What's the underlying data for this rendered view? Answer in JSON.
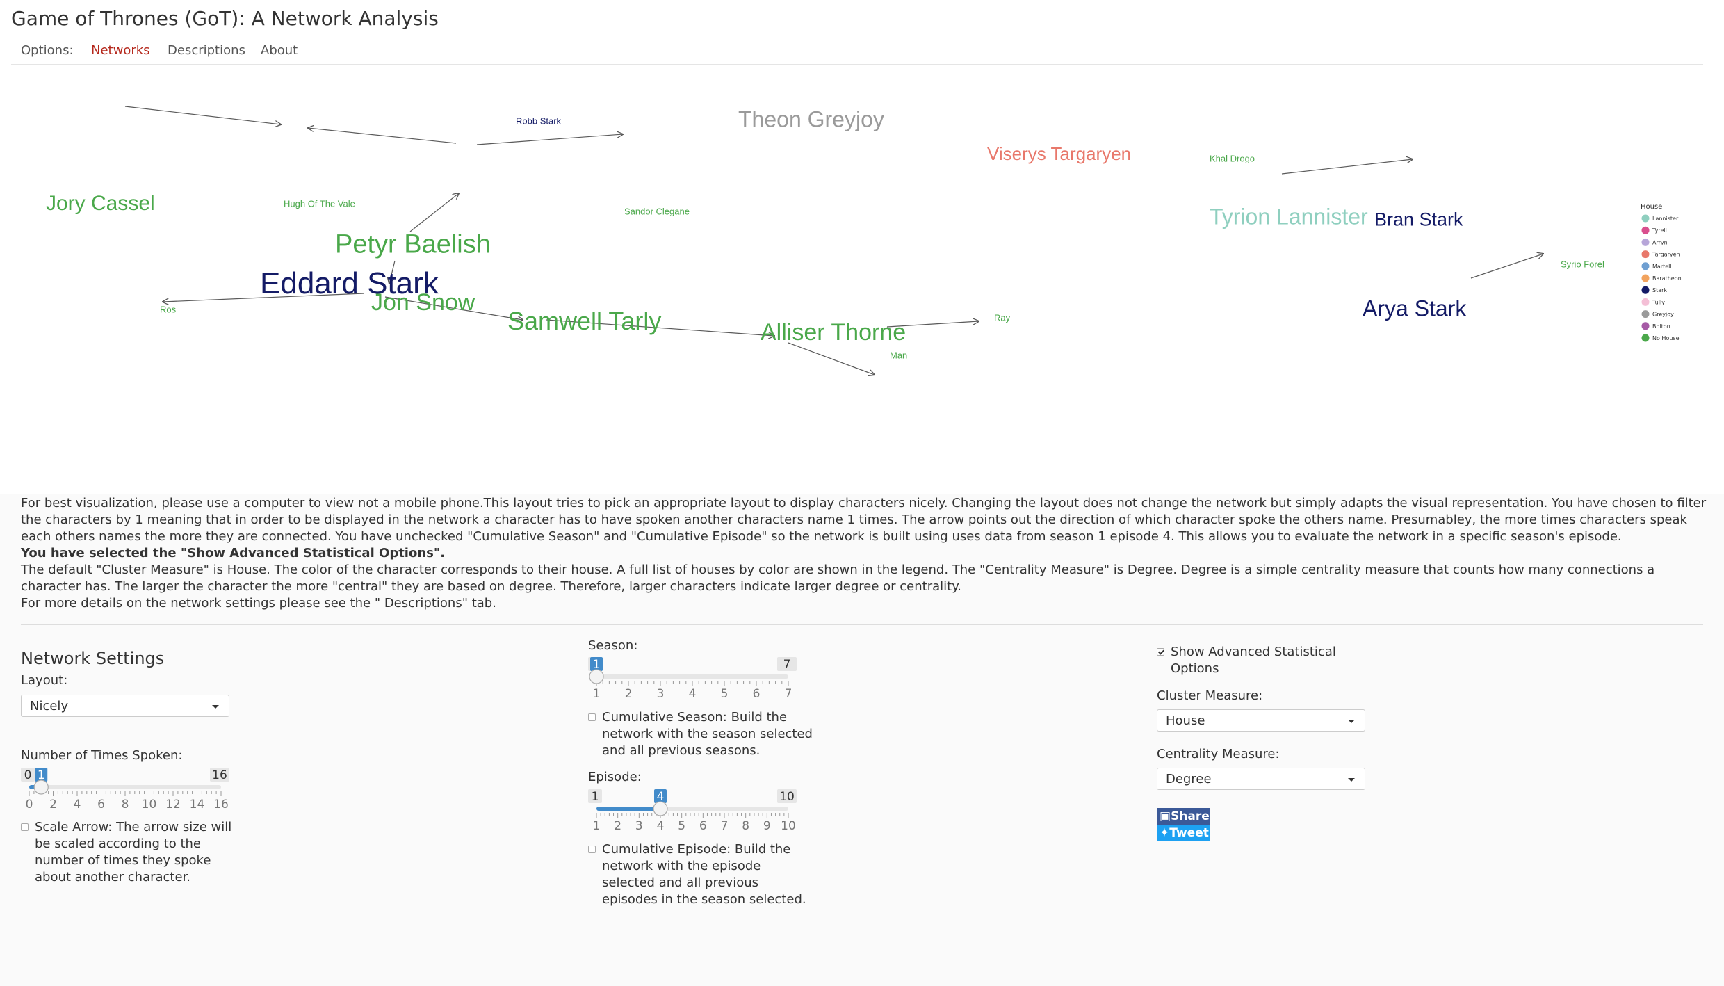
{
  "app_title": "Game of Thrones (GoT): A Network Analysis",
  "nav": {
    "label": "Options:",
    "tabs": [
      {
        "label": "Networks",
        "active": true
      },
      {
        "label": "Descriptions",
        "active": false
      },
      {
        "label": "About",
        "active": false
      }
    ]
  },
  "network": {
    "nodes": {
      "robb_stark": {
        "label": "Robb Stark",
        "color": "#141b66"
      },
      "theon_greyjoy": {
        "label": "Theon Greyjoy",
        "color": "#9a9a9a"
      },
      "viserys_targaryen": {
        "label": "Viserys Targaryen",
        "color": "#e8786b"
      },
      "khal_drogo": {
        "label": "Khal Drogo",
        "color": "#4aa84a"
      },
      "jory_cassel": {
        "label": "Jory Cassel",
        "color": "#4aa84a"
      },
      "hugh_of_the_vale": {
        "label": "Hugh Of The Vale",
        "color": "#4aa84a"
      },
      "sandor_clegane": {
        "label": "Sandor Clegane",
        "color": "#4aa84a"
      },
      "petyr_baelish": {
        "label": "Petyr Baelish",
        "color": "#4aa84a"
      },
      "tyrion_lannister": {
        "label": "Tyrion Lannister",
        "color": "#8fcfbf"
      },
      "bran_stark": {
        "label": "Bran Stark",
        "color": "#141b66"
      },
      "eddard_stark": {
        "label": "Eddard Stark",
        "color": "#141b66"
      },
      "jon_snow": {
        "label": "Jon Snow",
        "color": "#4aa84a"
      },
      "syrio_forel": {
        "label": "Syrio Forel",
        "color": "#4aa84a"
      },
      "arya_stark": {
        "label": "Arya Stark",
        "color": "#141b66"
      },
      "ros": {
        "label": "Ros",
        "color": "#4aa84a"
      },
      "samwell_tarly": {
        "label": "Samwell Tarly",
        "color": "#4aa84a"
      },
      "alliser_thorne": {
        "label": "Alliser Thorne",
        "color": "#4aa84a"
      },
      "ray": {
        "label": "Ray",
        "color": "#4aa84a"
      },
      "man": {
        "label": "Man",
        "color": "#4aa84a"
      }
    },
    "edges": [
      [
        "theon_greyjoy",
        "robb_stark"
      ],
      [
        "viserys_targaryen",
        "khal_drogo"
      ],
      [
        "jory_cassel",
        "hugh_of_the_vale"
      ],
      [
        "petyr_baelish",
        "hugh_of_the_vale"
      ],
      [
        "petyr_baelish",
        "sandor_clegane"
      ],
      [
        "eddard_stark",
        "petyr_baelish"
      ],
      [
        "tyrion_lannister",
        "bran_stark"
      ],
      [
        "eddard_stark",
        "jon_snow"
      ],
      [
        "jon_snow",
        "ros"
      ],
      [
        "jon_snow",
        "samwell_tarly"
      ],
      [
        "samwell_tarly",
        "alliser_thorne"
      ],
      [
        "alliser_thorne",
        "ray"
      ],
      [
        "alliser_thorne",
        "man"
      ],
      [
        "arya_stark",
        "syrio_forel"
      ]
    ],
    "legend": {
      "title": "House",
      "items": [
        {
          "label": "Lannister",
          "color": "#8fcfbf"
        },
        {
          "label": "Tyrell",
          "color": "#d94f8e"
        },
        {
          "label": "Arryn",
          "color": "#b7a6d9"
        },
        {
          "label": "Targaryen",
          "color": "#e8786b"
        },
        {
          "label": "Martell",
          "color": "#6f9fd1"
        },
        {
          "label": "Baratheon",
          "color": "#f2a35e"
        },
        {
          "label": "Stark",
          "color": "#141b66"
        },
        {
          "label": "Tully",
          "color": "#f4bfd6"
        },
        {
          "label": "Greyjoy",
          "color": "#9a9a9a"
        },
        {
          "label": "Bolton",
          "color": "#a65aa6"
        },
        {
          "label": "No House",
          "color": "#4aa84a"
        }
      ]
    }
  },
  "description": {
    "p1": "For best visualization, please use a computer to view not a mobile phone.This layout tries to pick an appropriate layout to display characters nicely. Changing the layout does not change the network but simply adapts the visual representation. You have chosen to filter the characters by 1 meaning that in order to be displayed in the network a character has to have spoken another characters name 1 times. The arrow points out the direction of which character spoke the others name. Presumabley, the more times characters speak each others names the more they are connected. You have unchecked \"Cumulative Season\" and \"Cumulative Episode\" so the network is built using uses data from season 1 episode 4. This allows you to evaluate the network in a specific season's episode.",
    "p2": "You have selected the \"Show Advanced Statistical Options\".",
    "p3": "The default \"Cluster Measure\" is House. The color of the character corresponds to their house. A full list of houses by color are shown in the legend. The \"Centrality Measure\" is Degree. Degree is a simple centrality measure that counts how many connections a character has. The larger the character the more \"central\" they are based on degree. Therefore, larger characters indicate larger degree or centrality.",
    "p4": "For more details on the network settings please see the \" Descriptions\" tab."
  },
  "settings": {
    "title": "Network Settings",
    "layout_label": "Layout:",
    "layout_value": "Nicely",
    "times_spoken": {
      "label": "Number of Times Spoken:",
      "min": 0,
      "max": 16,
      "value": 1,
      "ticks": [
        "0",
        "2",
        "4",
        "6",
        "8",
        "10",
        "12",
        "14",
        "16"
      ],
      "min_label": "0",
      "max_label": "16",
      "value_label": "1"
    },
    "scale_arrow": {
      "checked": false,
      "line1": "Scale Arrow: The arrow size will",
      "line2": "be scaled according to the",
      "line3": "number of times they spoke",
      "line4": "about another character."
    },
    "season": {
      "label": "Season:",
      "min": 1,
      "max": 7,
      "value": 1,
      "ticks": [
        "1",
        "2",
        "3",
        "4",
        "5",
        "6",
        "7"
      ],
      "min_label": "1",
      "max_label": "7",
      "value_label": "1"
    },
    "cumulative_season": {
      "checked": false,
      "line1": "Cumulative Season: Build the",
      "line2": "network with the season selected",
      "line3": "and all previous seasons."
    },
    "episode": {
      "label": "Episode:",
      "min": 1,
      "max": 10,
      "value": 4,
      "ticks": [
        "1",
        "2",
        "3",
        "4",
        "5",
        "6",
        "7",
        "8",
        "9",
        "10"
      ],
      "min_label": "1",
      "max_label": "10",
      "value_label": "4"
    },
    "cumulative_episode": {
      "checked": false,
      "line1": "Cumulative Episode: Build the",
      "line2": "network with the episode",
      "line3": "selected and all previous",
      "line4": "episodes in the season selected."
    },
    "advanced": {
      "checked": true,
      "line1": "Show Advanced Statistical",
      "line2": "Options"
    },
    "cluster_label": "Cluster Measure:",
    "cluster_value": "House",
    "centrality_label": "Centrality Measure:",
    "centrality_value": "Degree",
    "share_label": "Share",
    "tweet_label": "Tweet"
  }
}
